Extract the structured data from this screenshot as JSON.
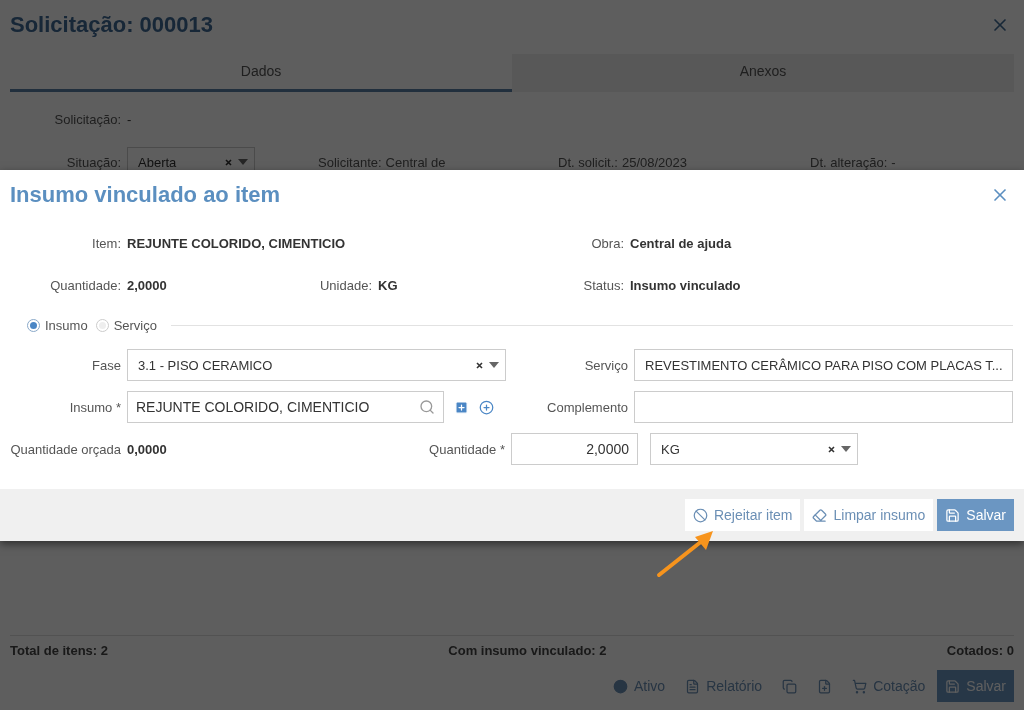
{
  "background": {
    "title": "Solicitação: 000013",
    "tabs": [
      {
        "label": "Dados",
        "selected": true
      },
      {
        "label": "Anexos",
        "selected": false
      }
    ],
    "request_field": {
      "label": "Solicitação:",
      "value": "-"
    },
    "status_select": {
      "label": "Situação:",
      "value": "Aberta"
    },
    "fields": [
      {
        "label": "Solicitante:",
        "value": "Central de"
      },
      {
        "label": "Dt. solicit.:",
        "value": "25/08/2023"
      },
      {
        "label": "Dt. alteração:",
        "value": "-"
      }
    ],
    "summary": [
      "Total de itens: 2",
      "Com insumo vinculado: 2",
      "Cotados: 0"
    ],
    "buttons": [
      {
        "label": "Ativo",
        "kind": "default"
      },
      {
        "label": "Relatório",
        "kind": "default"
      },
      {
        "kind": "icon"
      },
      {
        "kind": "icon"
      },
      {
        "label": "Cotação",
        "kind": "default"
      },
      {
        "label": "Salvar",
        "kind": "primary"
      }
    ]
  },
  "modal": {
    "title": "Insumo vinculado ao item",
    "info": [
      {
        "label": "Item:",
        "value": "REJUNTE COLORIDO, CIMENTICIO"
      },
      {
        "label": "Obra:",
        "value": "Central de ajuda"
      },
      {
        "label": "Quantidade:",
        "value": "2,0000"
      },
      {
        "label": "Unidade:",
        "value": "KG"
      },
      {
        "label": "Status:",
        "value": "Insumo vinculado"
      }
    ],
    "type_options": [
      {
        "label": "Insumo",
        "selected": true
      },
      {
        "label": "Serviço",
        "selected": false
      }
    ],
    "fase": {
      "label": "Fase",
      "value": "3.1 - PISO CERAMICO"
    },
    "servico": {
      "label": "Serviço",
      "value": "REVESTIMENTO CERÂMICO PARA PISO COM PLACAS T..."
    },
    "insumo": {
      "label": "Insumo *",
      "value": "REJUNTE COLORIDO, CIMENTICIO"
    },
    "complemento": {
      "label": "Complemento"
    },
    "quantidade_orcada": {
      "label": "Quantidade orçada",
      "value": "0,0000"
    },
    "quantidade": {
      "label": "Quantidade *",
      "value": "2,0000"
    },
    "unidade": {
      "value": "KG"
    },
    "buttons": [
      {
        "label": "Rejeitar item",
        "kind": "default"
      },
      {
        "label": "Limpar insumo",
        "kind": "default"
      },
      {
        "label": "Salvar",
        "kind": "primary"
      }
    ]
  }
}
